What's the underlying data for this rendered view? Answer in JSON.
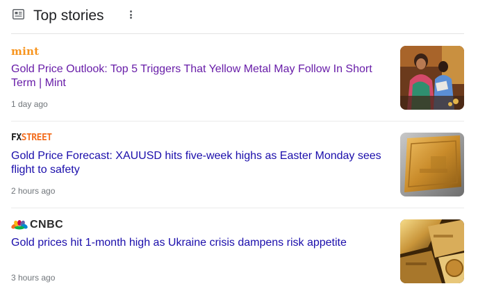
{
  "section": {
    "title": "Top stories",
    "icon": "newspaper-icon",
    "menu_icon": "more-vert-icon"
  },
  "stories": [
    {
      "source": "mint",
      "headline": "Gold Price Outlook: Top 5 Triggers That Yellow Metal May Follow In Short Term | Mint",
      "time": "1 day ago",
      "visited": true,
      "thumbnail": "women-buying-gold-jewelry-image"
    },
    {
      "source_parts": [
        "FX",
        "STREET"
      ],
      "headline": "Gold Price Forecast: XAUUSD hits five-week highs as Easter Monday sees flight to safety",
      "time": "2 hours ago",
      "visited": false,
      "thumbnail": "gold-bar-image"
    },
    {
      "source": "CNBC",
      "headline": "Gold prices hit 1-month high as Ukraine crisis dampens risk appetite",
      "time": "3 hours ago",
      "visited": false,
      "thumbnail": "gold-bars-pile-image"
    }
  ],
  "colors": {
    "link": "#1a0dab",
    "visited_link": "#681da8",
    "meta_text": "#70757a",
    "mint_orange": "#f7941d",
    "fxstreet_orange": "#f36f21"
  }
}
